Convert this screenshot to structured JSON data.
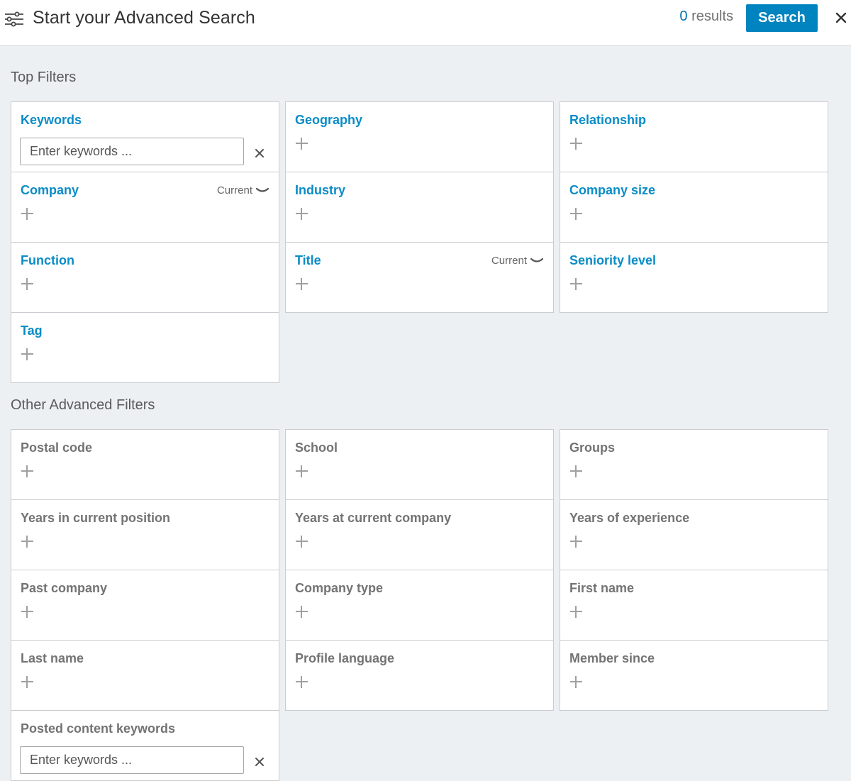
{
  "header": {
    "title": "Start your Advanced Search",
    "results_count": "0",
    "results_label": "results",
    "search_label": "Search",
    "icons": {
      "filter": "filter-sliders-icon",
      "close": "close-icon"
    },
    "colors": {
      "accent": "#0084bf",
      "link": "#0a8cc7"
    }
  },
  "top_filters": {
    "title": "Top Filters",
    "items": [
      {
        "label": "Keywords",
        "placeholder": "Enter keywords ..."
      },
      {
        "label": "Geography"
      },
      {
        "label": "Relationship"
      },
      {
        "label": "Company",
        "qualifier": "Current"
      },
      {
        "label": "Industry"
      },
      {
        "label": "Company size"
      },
      {
        "label": "Function"
      },
      {
        "label": "Title",
        "qualifier": "Current"
      },
      {
        "label": "Seniority level"
      },
      {
        "label": "Tag"
      }
    ]
  },
  "other_filters": {
    "title": "Other Advanced Filters",
    "items": [
      {
        "label": "Postal code"
      },
      {
        "label": "School"
      },
      {
        "label": "Groups"
      },
      {
        "label": "Years in current position"
      },
      {
        "label": "Years at current company"
      },
      {
        "label": "Years of experience"
      },
      {
        "label": "Past company"
      },
      {
        "label": "Company type"
      },
      {
        "label": "First name"
      },
      {
        "label": "Last name"
      },
      {
        "label": "Profile language"
      },
      {
        "label": "Member since"
      },
      {
        "label": "Posted content keywords",
        "placeholder": "Enter keywords ..."
      }
    ]
  }
}
